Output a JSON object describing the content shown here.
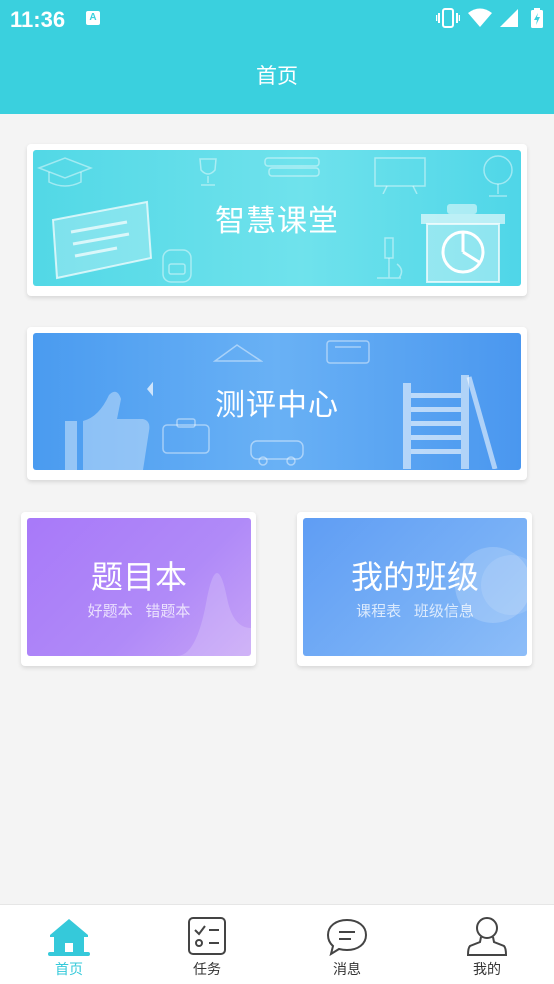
{
  "status_bar": {
    "time": "11:36",
    "notification_icon": "a-app-icon",
    "icons": [
      "vibrate-icon",
      "wifi-icon",
      "signal-icon",
      "battery-icon"
    ]
  },
  "header": {
    "title": "首页",
    "color": "#3ad0de"
  },
  "banners": [
    {
      "title": "智慧课堂",
      "theme": "#52d8e6"
    },
    {
      "title": "测评中心",
      "theme": "#4a9bf0"
    }
  ],
  "cards": [
    {
      "title": "题目本",
      "links": [
        "好题本",
        "错题本"
      ],
      "theme": "#a879f9"
    },
    {
      "title": "我的班级",
      "links": [
        "课程表",
        "班级信息"
      ],
      "theme": "#5f9df4"
    }
  ],
  "tabbar": {
    "active_color": "#35c9da",
    "items": [
      {
        "label": "首页",
        "icon": "home-icon",
        "active": true
      },
      {
        "label": "任务",
        "icon": "task-checklist-icon",
        "active": false
      },
      {
        "label": "消息",
        "icon": "message-bubble-icon",
        "active": false
      },
      {
        "label": "我的",
        "icon": "user-profile-icon",
        "active": false
      }
    ]
  }
}
